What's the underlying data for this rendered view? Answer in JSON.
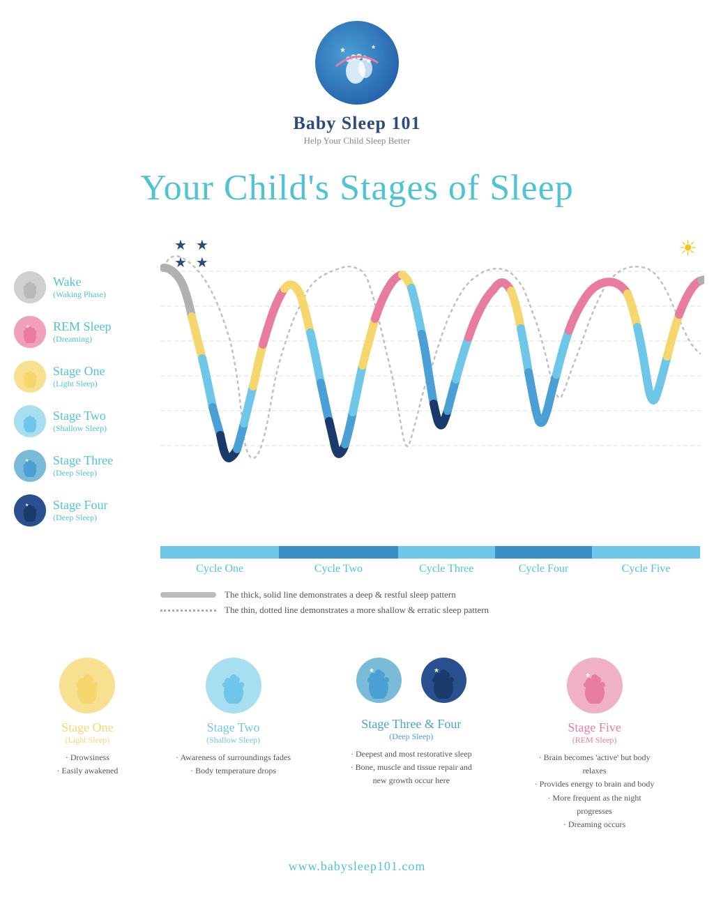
{
  "header": {
    "title": "Baby Sleep 101",
    "subtitle": "Help Your Child Sleep Better",
    "logo_alt": "baby footprints logo"
  },
  "main_title": "Your Child's Stages of Sleep",
  "legend": {
    "items": [
      {
        "id": "wake",
        "label": "Wake",
        "sublabel": "(Waking Phase)",
        "color": "#b0b0b0"
      },
      {
        "id": "rem",
        "label": "REM Sleep",
        "sublabel": "(Dreaming)",
        "color": "#e87ca0"
      },
      {
        "id": "stage1",
        "label": "Stage One",
        "sublabel": "(Light Sleep)",
        "color": "#f5d76e"
      },
      {
        "id": "stage2",
        "label": "Stage Two",
        "sublabel": "(Shallow Sleep)",
        "color": "#6ec6e8"
      },
      {
        "id": "stage3",
        "label": "Stage Three",
        "sublabel": "(Deep Sleep)",
        "color": "#4a9fd4"
      },
      {
        "id": "stage4",
        "label": "Stage Four",
        "sublabel": "(Deep Sleep)",
        "color": "#1a3a6b"
      }
    ]
  },
  "cycles": [
    {
      "label": "Cycle One",
      "color": "#6ec6e8",
      "width_pct": 22
    },
    {
      "label": "Cycle Two",
      "color": "#3a8fc4",
      "width_pct": 22
    },
    {
      "label": "Cycle Three",
      "color": "#6ec6e8",
      "width_pct": 18
    },
    {
      "label": "Cycle Four",
      "color": "#3a8fc4",
      "width_pct": 18
    },
    {
      "label": "Cycle Five",
      "color": "#6ec6e8",
      "width_pct": 20
    }
  ],
  "chart_legend": {
    "solid_text": "The thick, solid line demonstrates a deep & restful sleep pattern",
    "dotted_text": "The thin, dotted line demonstrates a more shallow & erratic sleep pattern"
  },
  "bottom_stages": [
    {
      "id": "stage1",
      "icon_color": "#f5d76e",
      "title": "Stage One",
      "subtitle": "(Light Sleep)",
      "bullet_color": "#f5d76e",
      "bullets": [
        "· Drowsiness",
        "· Easily awakened"
      ]
    },
    {
      "id": "stage2",
      "icon_color": "#6ec6e8",
      "title": "Stage Two",
      "subtitle": "(Shallow Sleep)",
      "bullet_color": "#6ec6e8",
      "bullets": [
        "· Awareness of surroundings fades",
        "· Body temperature drops"
      ]
    },
    {
      "id": "stage34",
      "icon_color": "#3a8fc4",
      "title": "Stage Three & Four",
      "subtitle": "(Deep Sleep)",
      "bullet_color": "#3a8fc4",
      "bullets": [
        "· Deepest and most restorative sleep",
        "· Bone, muscle and tissue repair and new growth occur here"
      ]
    },
    {
      "id": "stage5",
      "icon_color": "#e87ca0",
      "title": "Stage Five",
      "subtitle": "(REM Sleep)",
      "bullet_color": "#e87ca0",
      "bullets": [
        "· Brain becomes 'active' but body relaxes",
        "· Provides energy to brain and body",
        "· More frequent as the night progresses",
        "· Dreaming occurs"
      ]
    }
  ],
  "footer": {
    "url": "www.babysleep101.com"
  }
}
